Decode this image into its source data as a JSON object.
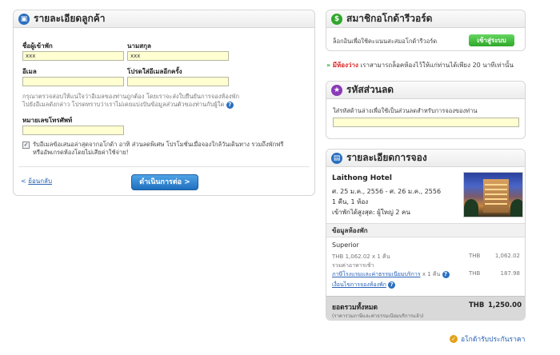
{
  "customer": {
    "title": "รายละเอียดลูกค้า",
    "first_name_label": "ชื่อผู้เข้าพัก",
    "first_name_value": "xxx",
    "last_name_label": "นามสกุล",
    "last_name_value": "xxx",
    "email_label": "อีเมล",
    "email_value": "",
    "email_confirm_label": "โปรดใส่อีเมลอีกครั้ง",
    "email_confirm_value": "",
    "email_note_1": "กรุณาตรวจสอบให้แน่ใจว่าอีเมลของท่านถูกต้อง โดยเราจะส่งใบยืนยันการจองห้องพัก",
    "email_note_2": "ไปยังอีเมลดังกล่าว โปรดทราบว่าเราไม่เคยแบ่งปันข้อมูลส่วนตัวของท่านกับผู้ใด",
    "phone_label": "หมายเลขโทรศัพท์",
    "phone_value": "",
    "newsletter_line_1": "รับอีเมลข้อเสนอล่าสุดจากอโกด้า อาทิ ส่วนลดพิเศษ โปรโมชั่นเมื่อจองใกล้วันเดินทาง รวมถึงพักฟรี",
    "newsletter_line_2": "หรืออัพเกรดห้องโดยไม่เสียค่าใช้จ่าย!",
    "back_link": "ย้อนกลับ",
    "next_button": "ดำเนินการต่อ >"
  },
  "member": {
    "title": "สมาชิกอโกด้ารีวอร์ด",
    "text": "ล็อกอินเพื่อใช้คะแนนสะสมอโกด้ารีวอร์ด",
    "login_button": "เข้าสู่ระบบ"
  },
  "promo": {
    "highlight": "มีห้องว่าง",
    "text": "เราสามารถล็อคห้องไว้ให้แก่ท่านได้เพียง 20 นาทีเท่านั้น"
  },
  "discount": {
    "title": "รหัสส่วนลด",
    "text": "ใส่รหัสด้านล่างเพื่อใช้เป็นส่วนลดสำหรับการจองของท่าน",
    "code_value": ""
  },
  "booking": {
    "title": "รายละเอียดการจอง",
    "hotel_name": "Laithong Hotel",
    "dates": "ศ. 25 ม.ค., 2556 - ศ. 26 ม.ค., 2556",
    "nights_rooms": "1 คืน, 1 ห้อง",
    "guests": "เข้าพักได้สูงสุด: ผู้ใหญ่ 2 คน",
    "room_info_header": "ข้อมูลห้องพัก",
    "room_type": "Superior",
    "rate_line": "THB 1,062.02 x 1 คืน",
    "rate_currency": "THB",
    "rate_amount": "1,062.02",
    "breakfast": "รวมค่าอาหารเช้า",
    "tax_link": "ภาษีโรงแรมและค่าธรรมเนียมบริการ",
    "tax_mult": "x 1 คืน",
    "tax_currency": "THB",
    "tax_amount": "187.98",
    "policy_link": "เงื่อนไขการจองห้องพัก",
    "total_label": "ยอดรวมทั้งหมด",
    "total_sub": "(ราคารวมภาษีและค่าธรรมเนียมบริการแล้ว)",
    "total_currency": "THB",
    "total_amount": "1,250.00"
  },
  "guarantee": "อโกด้ารับประกันราคา",
  "colors": {
    "blue_button": "#1f6fbf",
    "green_button": "#2ea82a",
    "input_bg": "#ffffd2",
    "link": "#2a62b5"
  }
}
